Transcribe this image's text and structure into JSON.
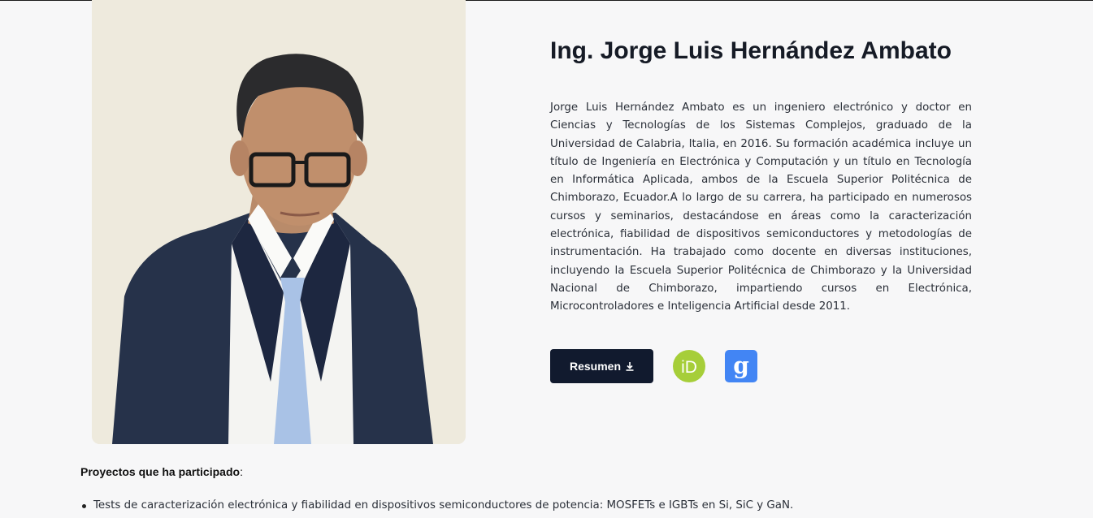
{
  "profile": {
    "name": "Ing. Jorge Luis Hernández Ambato",
    "bio": "Jorge Luis Hernández Ambato es un ingeniero electrónico y doctor en Ciencias y Tecnologías de los Sistemas Complejos, graduado de la Universidad de Calabria, Italia, en 2016. Su formación académica incluye un título de Ingeniería en Electrónica y Computación y un título en Tecnología en Informática Aplicada, ambos de la Escuela Superior Politécnica de Chimborazo, Ecuador.A lo largo de su carrera, ha participado en numerosos cursos y seminarios, destacándose en áreas como la caracterización electrónica, fiabilidad de dispositivos semiconductores y metodologías de instrumentación. Ha trabajado como docente en diversas instituciones, incluyendo la Escuela Superior Politécnica de Chimborazo y la Universidad Nacional de Chimborazo, impartiendo cursos en Electrónica, Microcontroladores e Inteligencia Artificial desde 2011."
  },
  "actions": {
    "resume_label": "Resumen",
    "resume_icon": "download-icon",
    "orcid_label": "iD",
    "orcid_color": "#a6ce39",
    "scholar_label": "g",
    "scholar_color": "#4285f4",
    "button_color": "#111a2e"
  },
  "projects": {
    "heading": "Proyectos que ha participado",
    "heading_suffix": ":",
    "items": [
      "Tests de caracterización electrónica y fiabilidad en dispositivos semiconductores de potencia: MOSFETs e IGBTs en Si, SiC y GaN."
    ]
  }
}
